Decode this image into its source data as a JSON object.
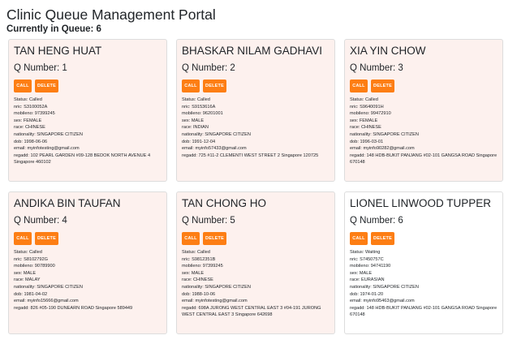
{
  "header": {
    "title": "Clinic Queue Management Portal",
    "queue_count": "Currently in Queue: 6"
  },
  "buttons": {
    "call": "CALL",
    "delete": "DELETE"
  },
  "patients": [
    {
      "name": "TAN HENG HUAT",
      "q_number": "Q Number: 1",
      "status": "Status: Called",
      "nric": "nric: S3100052A",
      "mobileno": "mobileno: 97399245",
      "sex": "sex: FEMALE",
      "race": "race: CHINESE",
      "nationality": "nationality: SINGAPORE CITIZEN",
      "dob": "dob: 1998-06-06",
      "email": "email: myinfotesting@gmail.com",
      "regadd": "regadd: 102 PEARL GARDEN #09-128 BEDOK NORTH AVENUE 4 Singapore 460102"
    },
    {
      "name": "BHASKAR NILAM GADHAVI",
      "q_number": "Q Number: 2",
      "status": "Status: Called",
      "nric": "nric: S9153616A",
      "mobileno": "mobileno: 96201001",
      "sex": "sex: MALE",
      "race": "race: INDIAN",
      "nationality": "nationality: SINGAPORE CITIZEN",
      "dob": "dob: 1991-12-04",
      "email": "email: myinfo57433@gmail.com",
      "regadd": "regadd: 725 #11-2 CLEMENTI WEST STREET 2 Singapore 120725"
    },
    {
      "name": "XIA YIN CHOW",
      "q_number": "Q Number: 3",
      "status": "Status: Called",
      "nric": "nric: S9640091H",
      "mobileno": "mobileno: 99472910",
      "sex": "sex: FEMALE",
      "race": "race: CHINESE",
      "nationality": "nationality: SINGAPORE CITIZEN",
      "dob": "dob: 1996-03-01",
      "email": "email: myinfo90282@gmail.com",
      "regadd": "regadd: 148 HDB-BUKIT PANJANG #02-101 GANGSA ROAD Singapore 670148"
    },
    {
      "name": "ANDIKA BIN TAUFAN",
      "q_number": "Q Number: 4",
      "status": "Status: Called",
      "nric": "nric: S8102792G",
      "mobileno": "mobileno: 90789900",
      "sex": "sex: MALE",
      "race": "race: MALAY",
      "nationality": "nationality: SINGAPORE CITIZEN",
      "dob": "dob: 1981-04-02",
      "email": "email: myinfo15666@gmail.com",
      "regadd": "regadd: 826 #05-190 DUNEARN ROAD Singapore 589449"
    },
    {
      "name": "TAN CHONG HO",
      "q_number": "Q Number: 5",
      "status": "Status: Called",
      "nric": "nric: S9812351B",
      "mobileno": "mobileno: 97399245",
      "sex": "sex: MALE",
      "race": "race: CHINESE",
      "nationality": "nationality: SINGAPORE CITIZEN",
      "dob": "dob: 1988-10-06",
      "email": "email: myinfotesting@gmail.com",
      "regadd": "regadd: 698A JURONG WEST CENTRAL EAST 3 #04-191 JURONG WEST CENTRAL EAST 3 Singapore 642698"
    },
    {
      "name": "LIONEL LINWOOD TUPPER",
      "q_number": "Q Number: 6",
      "status": "Status: Waiting",
      "nric": "nric: S7450757C",
      "mobileno": "mobileno: 94741190",
      "sex": "sex: MALE",
      "race": "race: EURASIAN",
      "nationality": "nationality: SINGAPORE CITIZEN",
      "dob": "dob: 1974-01-20",
      "email": "email: myinfo95463@gmail.com",
      "regadd": "regadd: 148 HDB-BUKIT PANJANG #02-101 GANGSA ROAD Singapore 670148"
    }
  ]
}
